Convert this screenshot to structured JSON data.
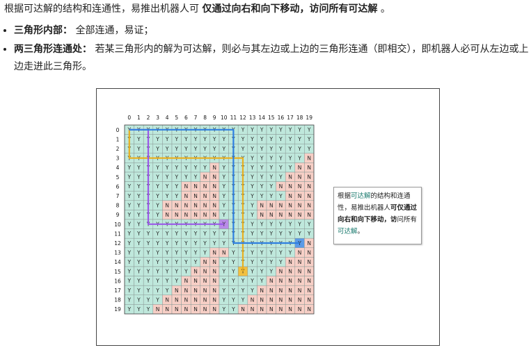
{
  "intro": {
    "text_before": "根据可达解的结构和连通性，易推出机器人可",
    "bold": "仅通过向右和向下移动，访问所有可达解",
    "text_after": "。"
  },
  "bullets": [
    {
      "label": "三角形内部：",
      "text": "全部连通，易证；"
    },
    {
      "label": "两三角形连通处：",
      "text": "若某三角形内的解为可达解，则必与其左边或上边的三角形连通（即相交），即机器人必可从左边或上边走进此三角形。"
    }
  ],
  "figure": {
    "col_labels": [
      "0",
      "1",
      "2",
      "3",
      "4",
      "5",
      "6",
      "7",
      "8",
      "9",
      "10",
      "11",
      "12",
      "13",
      "14",
      "15",
      "16",
      "17",
      "18",
      "19"
    ],
    "row_labels": [
      "0",
      "1",
      "2",
      "3",
      "4",
      "5",
      "6",
      "7",
      "8",
      "9",
      "10",
      "11",
      "12",
      "13",
      "14",
      "15",
      "16",
      "17",
      "18",
      "19"
    ],
    "grid": [
      "YYYYYYYYYYYYYYYYYYYY",
      "YYYYYYYYYYYYYYYYYYYY",
      "YYYYYYYYYYYYYYYYYYYY",
      "YYYYYYYYYYYYYYYYYYYN",
      "YYYYYYYYYNYYYYYYYYNN",
      "YYYYYYYYNNYYYYYYYNNN",
      "YYYYYYNNNNYYYYYYNNNN",
      "YYYYYYNNNNYYYYYYYNNN",
      "YYYYNNNNNNYYYYNNNNNN",
      "YYYYNNNNNNYYYYNNNNNN",
      "YYYYYYYYYYYYYYYYYYYY",
      "YYYYYYYYYYYYYYYYYYYY",
      "YYYYYYYYYYYYYYYYYYYN",
      "YYYYYYYYYNNYYYYYYYNN",
      "YYYYYYYYNNYYYYYYYNNN",
      "YYYYYYYNNNYYYYYYNNNN",
      "YYYYYYNNNNYYYYYNNNNN",
      "YYYYYNNNNNYYYYNNNNNN",
      "YYYYNNNNNNYYYNNNNNNN",
      "YYYNNNNNNNYYNNNNNNNN"
    ],
    "colors": {
      "reachable": "#bfe8dc",
      "unreachable": "#f7cfc6",
      "blue_path": "#2e7fe0",
      "purple_path": "#9b59e8",
      "orange_path": "#e8b020",
      "blue_end_cell": "#5b9be8",
      "purple_end_cell": "#b98be8",
      "orange_end_cell": "#f2c040"
    },
    "callout": {
      "p1": "根据",
      "h1": "可达解",
      "p2": "的结构和连通性，易推出机器人",
      "b1": "可仅通过向右和向下移动，访",
      "b2": "问所有",
      "h2": "可达解",
      "p3": "。"
    }
  }
}
